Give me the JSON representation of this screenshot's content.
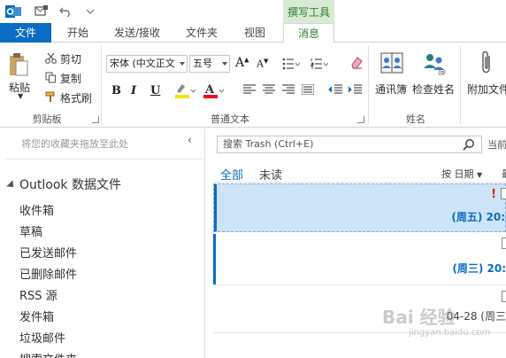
{
  "context_tab_group": "撰写工具",
  "tabs": [
    "文件",
    "开始",
    "发送/接收",
    "文件夹",
    "视图",
    "消息"
  ],
  "ribbon": {
    "clipboard": {
      "paste": "粘贴",
      "cut": "剪切",
      "copy": "复制",
      "format_painter": "格式刷",
      "label": "剪贴板"
    },
    "basic_text": {
      "font_name": "宋体 (中文正文",
      "font_size": "五号",
      "label": "普通文本",
      "bold": "B",
      "italic": "I",
      "underline": "U"
    },
    "names": {
      "address_book": "通讯簿",
      "check_names": "检查姓名",
      "label": "姓名"
    },
    "include": {
      "attach_file": "附加文件"
    }
  },
  "nav": {
    "favorites_hint": "将您的收藏夹拖放至此处",
    "root": "Outlook 数据文件",
    "folders": [
      "收件箱",
      "草稿",
      "已发送邮件",
      "已删除邮件",
      "RSS 源",
      "发件箱",
      "垃圾邮件",
      "搜索文件夹"
    ]
  },
  "list": {
    "search_placeholder": "搜索 Trash (Ctrl+E)",
    "scope": "当前",
    "filter_all": "全部",
    "filter_unread": "未读",
    "sort_by": "按 日期",
    "sort_order": "最",
    "items": [
      {
        "date": "(周五) 20:",
        "important": "!"
      },
      {
        "date": "(周三) 20:"
      },
      {
        "date": "04-28 (周三"
      }
    ]
  },
  "watermark": {
    "brand": "Bai 经验",
    "url": "jingyan.baidu.com"
  },
  "colors": {
    "accent": "#0a6cc2",
    "context_tab": "#d7ead4",
    "selected_row": "#cde3f7"
  }
}
